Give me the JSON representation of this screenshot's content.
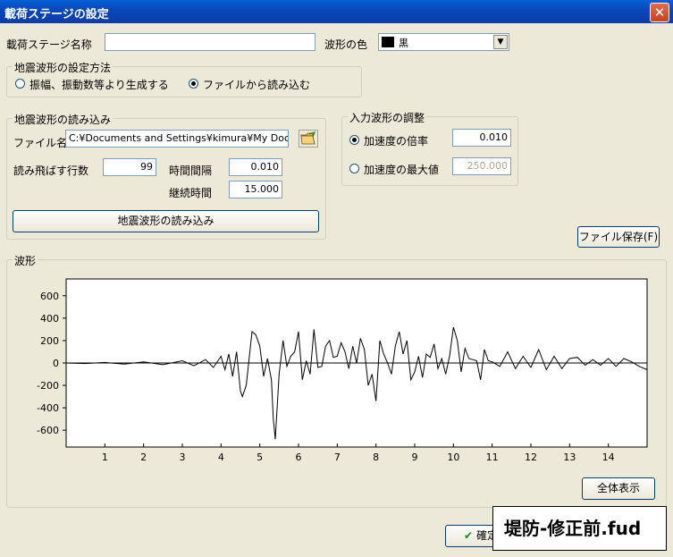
{
  "window": {
    "title": "載荷ステージの設定",
    "close": "✕"
  },
  "stage_name": {
    "label": "載荷ステージ名称",
    "value": ""
  },
  "waveform_color": {
    "label": "波形の色",
    "value": "黒",
    "color": "#000000"
  },
  "generation_method": {
    "title": "地震波形の設定方法",
    "options": [
      {
        "label": "振幅、振動数等より生成する",
        "checked": false
      },
      {
        "label": "ファイルから読み込む",
        "checked": true
      }
    ]
  },
  "loading": {
    "title": "地震波形の読み込み",
    "file_label": "ファイル名",
    "file_value": "C:¥Documents and Settings¥kimura¥My Docur",
    "skip_rows_label": "読み飛ばす行数",
    "skip_rows_value": "99",
    "interval_label": "時間間隔",
    "interval_value": "0.010",
    "duration_label": "継続時間",
    "duration_value": "15.000",
    "load_button": "地震波形の読み込み"
  },
  "adjustment": {
    "title": "入力波形の調整",
    "options": [
      {
        "label": "加速度の倍率",
        "value": "0.010",
        "checked": true
      },
      {
        "label": "加速度の最大値",
        "value": "250.000",
        "checked": false
      }
    ]
  },
  "file_save_button": "ファイル保存(F)",
  "waveform_group": {
    "title": "波形"
  },
  "show_all_button": "全体表示",
  "ok_button": "確定",
  "overlay_caption": "堤防-修正前.fud",
  "chart_data": {
    "type": "line",
    "title": "",
    "xlabel": "",
    "ylabel": "",
    "xlim": [
      0,
      15
    ],
    "ylim": [
      -750,
      750
    ],
    "xticks": [
      1,
      2,
      3,
      4,
      5,
      6,
      7,
      8,
      9,
      10,
      11,
      12,
      13,
      14
    ],
    "yticks": [
      600,
      400,
      200,
      0,
      -200,
      -400,
      -600
    ],
    "grid": false,
    "series": [
      {
        "name": "",
        "color": "#000000",
        "x": [
          0,
          0.5,
          1,
          1.5,
          2,
          2.5,
          3,
          3.3,
          3.6,
          3.8,
          4.0,
          4.1,
          4.2,
          4.3,
          4.4,
          4.5,
          4.55,
          4.65,
          4.8,
          4.9,
          5.0,
          5.1,
          5.2,
          5.3,
          5.35,
          5.4,
          5.5,
          5.6,
          5.7,
          5.8,
          5.9,
          6.0,
          6.1,
          6.2,
          6.3,
          6.4,
          6.5,
          6.6,
          6.7,
          6.8,
          6.9,
          7.0,
          7.1,
          7.2,
          7.3,
          7.4,
          7.5,
          7.6,
          7.7,
          7.8,
          7.9,
          8.0,
          8.1,
          8.2,
          8.3,
          8.4,
          8.5,
          8.6,
          8.7,
          8.8,
          8.9,
          9.0,
          9.1,
          9.2,
          9.3,
          9.4,
          9.5,
          9.6,
          9.7,
          9.8,
          9.9,
          10.0,
          10.1,
          10.2,
          10.3,
          10.4,
          10.5,
          10.6,
          10.7,
          10.8,
          10.9,
          11.0,
          11.2,
          11.4,
          11.6,
          11.8,
          12.0,
          12.2,
          12.4,
          12.6,
          12.8,
          13.0,
          13.2,
          13.4,
          13.6,
          13.8,
          14.0,
          14.2,
          14.4,
          14.6,
          14.8,
          15.0
        ],
        "y": [
          0,
          -5,
          5,
          -10,
          10,
          -15,
          20,
          -25,
          30,
          -40,
          60,
          -60,
          80,
          -120,
          100,
          -250,
          -300,
          -200,
          280,
          250,
          150,
          -120,
          40,
          -150,
          -500,
          -680,
          -100,
          200,
          -30,
          60,
          100,
          280,
          -150,
          20,
          -100,
          300,
          -40,
          -30,
          150,
          200,
          50,
          60,
          180,
          100,
          -50,
          150,
          0,
          220,
          120,
          -200,
          -100,
          -340,
          200,
          80,
          0,
          -100,
          150,
          280,
          80,
          200,
          -150,
          -80,
          60,
          -130,
          80,
          50,
          170,
          -50,
          40,
          -100,
          60,
          320,
          200,
          -80,
          130,
          40,
          30,
          20,
          -150,
          120,
          20,
          10,
          -30,
          100,
          -50,
          60,
          -40,
          120,
          -60,
          60,
          -50,
          40,
          50,
          -20,
          30,
          -20,
          40,
          -30,
          40,
          10,
          -30,
          -60
        ]
      }
    ]
  }
}
